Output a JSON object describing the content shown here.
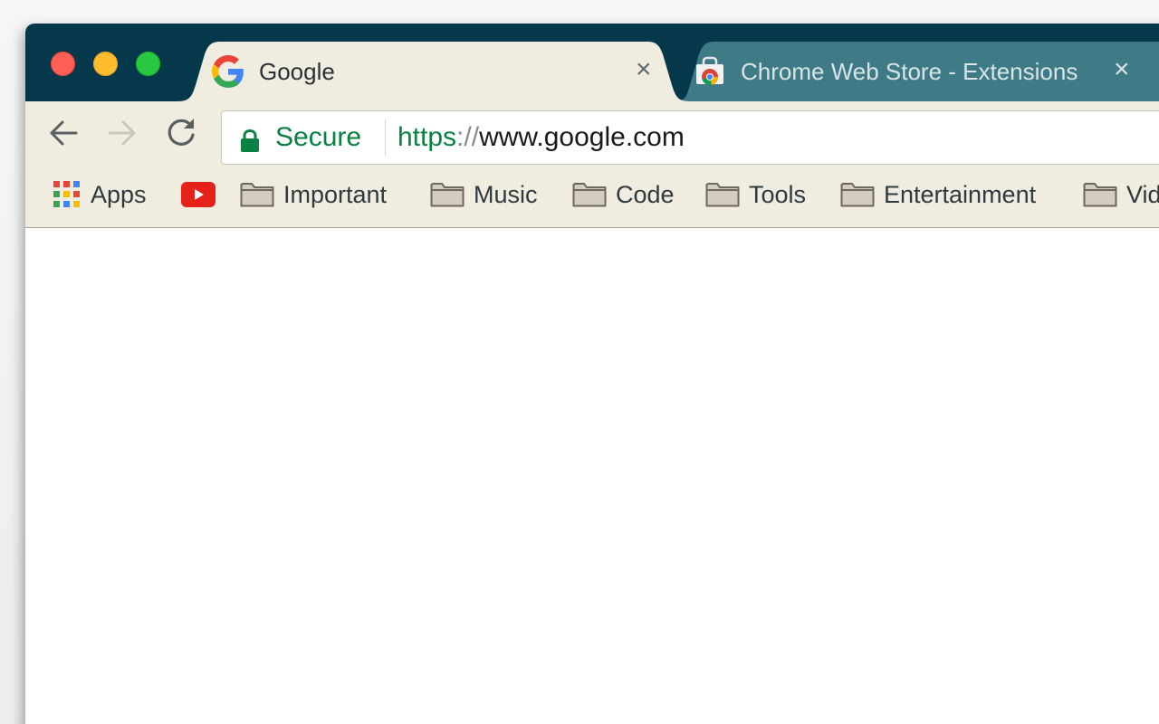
{
  "window": {
    "controls": [
      "close",
      "minimize",
      "maximize"
    ]
  },
  "tabs": [
    {
      "title": "Google",
      "icon": "google-g-icon",
      "active": true,
      "close_glyph": "×"
    },
    {
      "title": "Chrome Web Store - Extensions",
      "icon": "chrome-web-store-icon",
      "active": false,
      "close_glyph": "×"
    }
  ],
  "toolbar": {
    "back": "back-arrow-icon",
    "forward": "forward-arrow-icon",
    "reload": "reload-icon"
  },
  "omnibox": {
    "security_label": "Secure",
    "url_scheme": "https",
    "url_separator": "://",
    "url_host": "www.google.com"
  },
  "bookmarks": [
    {
      "label": "Apps",
      "icon": "apps-grid-icon"
    },
    {
      "label": "",
      "icon": "youtube-icon"
    },
    {
      "label": "Important",
      "icon": "folder-icon"
    },
    {
      "label": "Music",
      "icon": "folder-icon"
    },
    {
      "label": "Code",
      "icon": "folder-icon"
    },
    {
      "label": "Tools",
      "icon": "folder-icon"
    },
    {
      "label": "Entertainment",
      "icon": "folder-icon"
    },
    {
      "label": "Vid",
      "icon": "folder-icon"
    }
  ],
  "colors": {
    "tabstrip": "#05384a",
    "toolbar": "#f1ece0",
    "secure_green": "#0b8043"
  }
}
